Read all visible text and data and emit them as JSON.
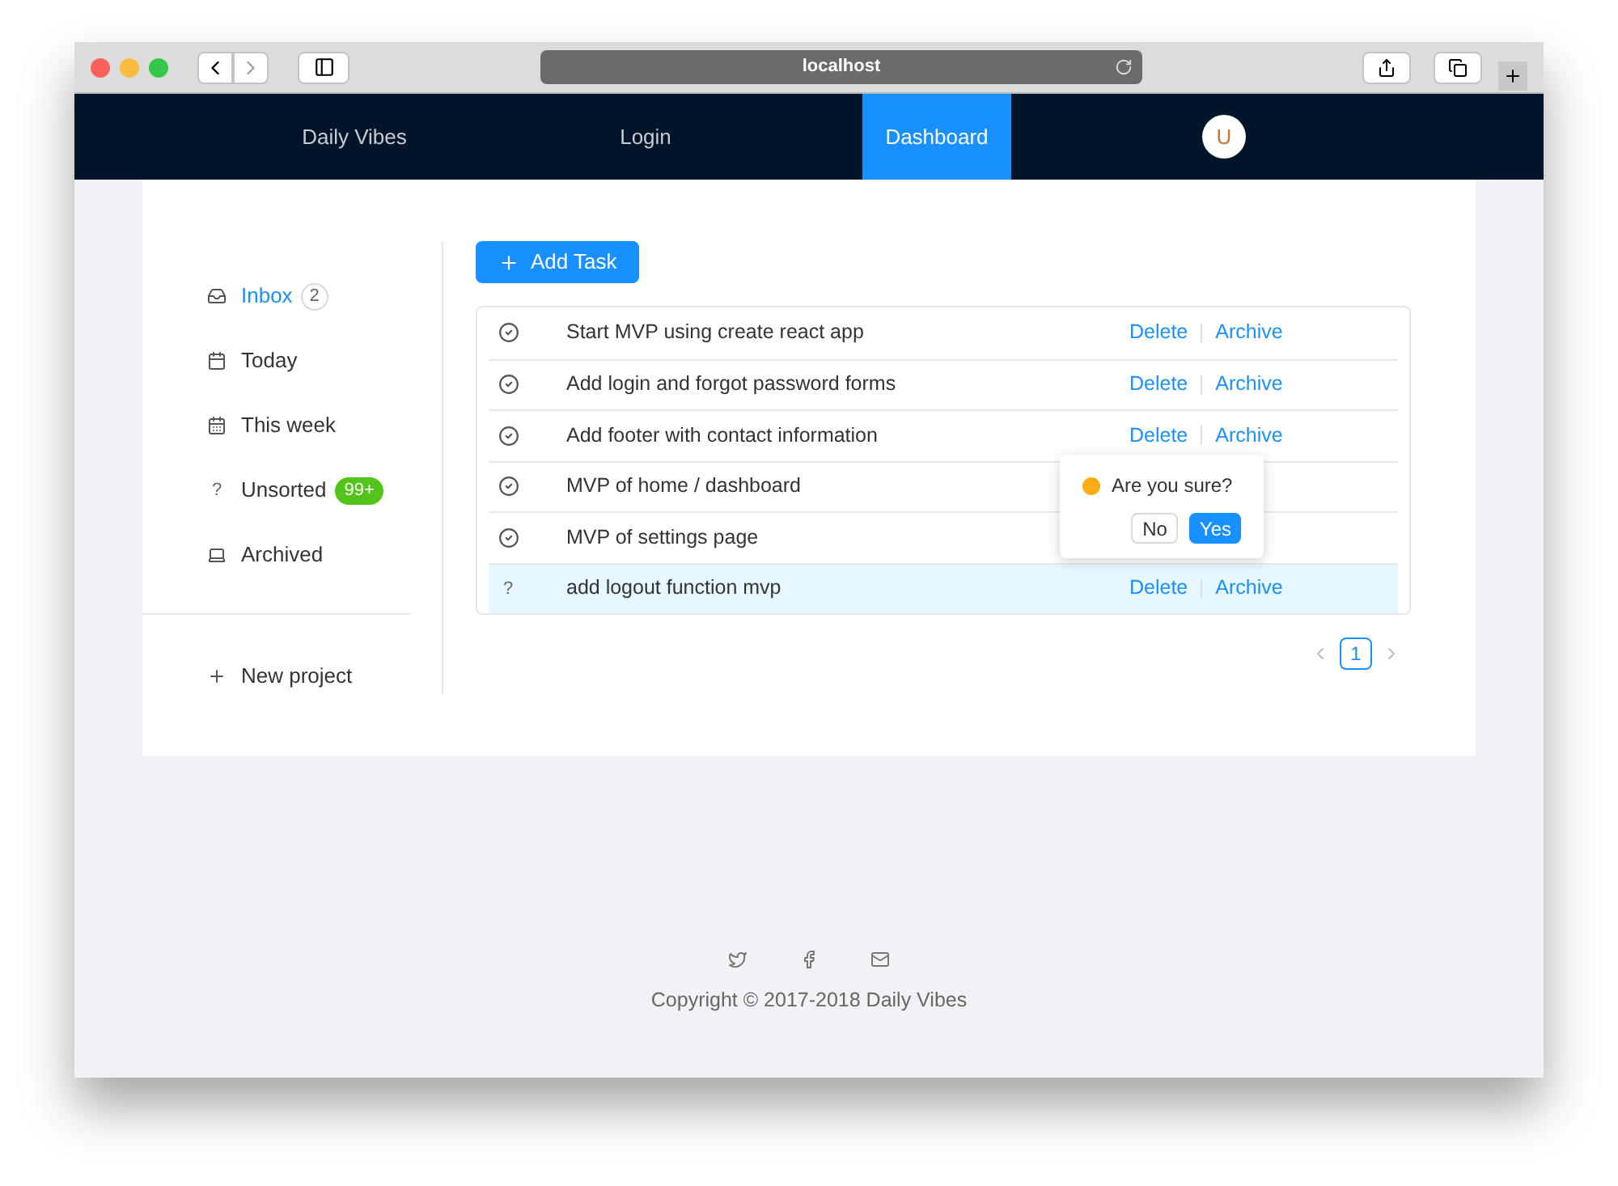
{
  "browser": {
    "url": "localhost"
  },
  "nav": {
    "items": [
      {
        "label": "Daily Vibes",
        "selected": false
      },
      {
        "label": "Login",
        "selected": false
      },
      {
        "label": "Dashboard",
        "selected": true
      }
    ],
    "avatar": "U"
  },
  "sidebar": {
    "items": [
      {
        "label": "Inbox",
        "kind": "inbox",
        "selected": true,
        "badge": {
          "text": "2",
          "kind": "outline"
        }
      },
      {
        "label": "Today",
        "kind": "today",
        "selected": false
      },
      {
        "label": "This week",
        "kind": "week",
        "selected": false
      },
      {
        "label": "Unsorted",
        "kind": "unsorted",
        "glyph": "?",
        "selected": false,
        "badge": {
          "text": "99+",
          "kind": "green"
        }
      },
      {
        "label": "Archived",
        "kind": "archived",
        "selected": false
      }
    ],
    "new_project": "New project"
  },
  "add_button": "Add Task",
  "tasks": [
    {
      "kind": "done",
      "title": "Start MVP using create react app",
      "highlighted": false,
      "actions": [
        "Delete",
        "Archive"
      ]
    },
    {
      "kind": "done",
      "title": "Add login and forgot password forms",
      "highlighted": false,
      "actions": [
        "Delete",
        "Archive"
      ]
    },
    {
      "kind": "done",
      "title": "Add footer with contact information",
      "highlighted": false,
      "actions": [
        "Delete",
        "Archive"
      ]
    },
    {
      "kind": "done",
      "title": "MVP of home / dashboard",
      "highlighted": false
    },
    {
      "kind": "done",
      "title": "MVP of settings page",
      "highlighted": false
    },
    {
      "kind": "unsorted",
      "glyph": "?",
      "title": "add logout function mvp",
      "highlighted": true,
      "actions": [
        "Delete",
        "Archive"
      ]
    }
  ],
  "confirm": {
    "message": "Are you sure?",
    "no": "No",
    "yes": "Yes"
  },
  "pagination": {
    "pages": [
      {
        "label": "1",
        "selected": true
      }
    ]
  },
  "footer": {
    "copyright": "Copyright © 2017-2018 Daily Vibes"
  }
}
